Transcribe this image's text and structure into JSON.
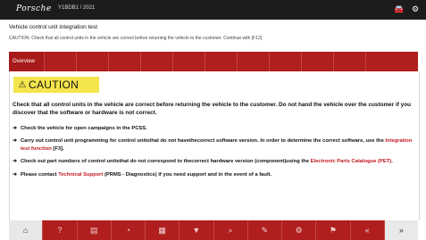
{
  "header": {
    "brand": "Porsche",
    "vin": "Y1BDB1 / 2021",
    "icons": [
      "car-icon",
      "settings-icon"
    ]
  },
  "page": {
    "title": "Vehicle control unit integration test",
    "instruction": "CAUTION: Check that all control units in the vehicle are correct before returning the vehicle to the customer. Continue with [F12]."
  },
  "tabs": {
    "active_label": "Overview"
  },
  "caution": {
    "label": "CAUTION",
    "icon": "warning-triangle-icon",
    "banner_color": "#f4e54c"
  },
  "content": {
    "main_text": "Check that all control units in the vehicle are correct before returning the vehicle to the customer. Do not hand the vehicle over the customer if you discover that the software or hardware is not correct.",
    "bullet1": "Check the vehicle for open campaigns in the PCSS.",
    "bullet2_pre": "Carry out control unit programming for control unitsthat do not havethecorrect software version. In order to determine the correct software, use the ",
    "bullet2_link": "Integration test function",
    "bullet2_post": " [F3].",
    "bullet3_pre": "Check out part numbers of control unitsthat do not correspond to thecorrect hardware version (component)using the ",
    "bullet3_link": "Electronic Parts Catalogue (PET)",
    "bullet3_post": ".",
    "bullet4_pre": "Please contact ",
    "bullet4_link": "Technical Support",
    "bullet4_post": " (PRMS - Diagnostics) if you need support and in the event of a fault."
  },
  "bottom_toolbar": {
    "icons": [
      "home-icon",
      "help-icon",
      "vehicle-icon",
      "measure-icon",
      "print-icon",
      "filter-icon",
      "search-icon",
      "tools-icon",
      "settings-icon",
      "flag-icon",
      "back-icon",
      "next-icon"
    ],
    "accent": "#b01e1e"
  }
}
